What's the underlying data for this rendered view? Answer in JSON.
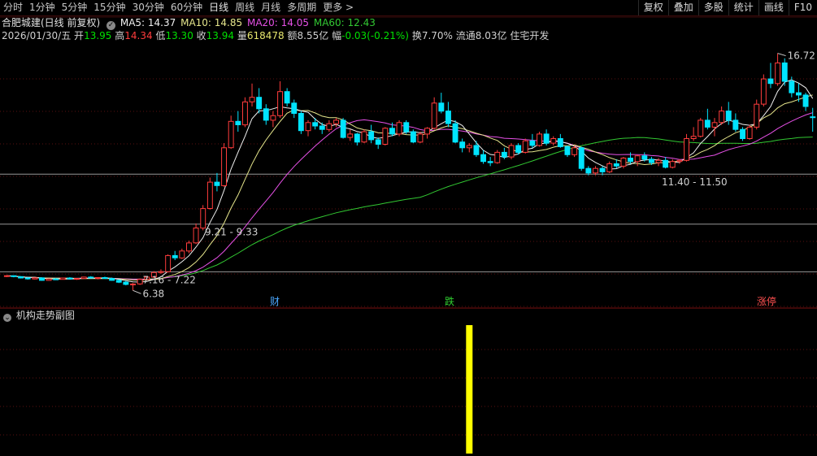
{
  "toolbar": {
    "tabs": [
      "分时",
      "1分钟",
      "5分钟",
      "15分钟",
      "30分钟",
      "60分钟",
      "日线",
      "周线",
      "月线",
      "多周期",
      "更多 >"
    ],
    "active_index": 6,
    "tools": [
      "复权",
      "叠加",
      "多股",
      "统计",
      "画线",
      "F10"
    ]
  },
  "info": {
    "stock_name": "合肥城建(日线 前复权)",
    "ma5": "MA5: 14.37",
    "ma10": "MA10: 14.85",
    "ma20": "MA20: 14.05",
    "ma60": "MA60: 12.43",
    "date": "2026/01/30/五",
    "open_label": "开",
    "open": "13.95",
    "high_label": "高",
    "high": "14.34",
    "low_label": "低",
    "low": "13.30",
    "close_label": "收",
    "close": "13.94",
    "volume_label": "量",
    "volume": "618478",
    "amount_label": "额",
    "amount": "8.55亿",
    "change_label": "幅",
    "change": "-0.03(-0.21%)",
    "turnover": "换7.70%",
    "float_cap": "流通8.03亿",
    "sector": "住宅开发"
  },
  "annotations": {
    "high_mark": "16.72",
    "low_mark": "6.38",
    "range1": "7.16 - 7.22",
    "range2": "9.21 - 9.33",
    "range3": "11.40 - 11.50",
    "marker_cai": "财",
    "marker_die": "跌",
    "marker_zhangting": "涨停"
  },
  "sub_panel": {
    "title": "机构走势副图"
  },
  "colors": {
    "up": "#ff3c3c",
    "down": "#00e4ff",
    "ma5": "#f0f0f0",
    "ma10": "#e6e68c",
    "ma20": "#e650e6",
    "ma60": "#32c832",
    "level": "#969696",
    "bar": "#ffff00"
  },
  "chart_data": {
    "type": "candlestick",
    "y_range": [
      6.0,
      17.2
    ],
    "candles": [
      [
        7.0,
        7.05,
        6.96,
        7.02
      ],
      [
        7.02,
        7.02,
        6.95,
        6.98
      ],
      [
        6.98,
        7.0,
        6.9,
        6.92
      ],
      [
        6.92,
        6.95,
        6.85,
        6.88
      ],
      [
        6.88,
        6.95,
        6.86,
        6.93
      ],
      [
        6.93,
        6.95,
        6.8,
        6.82
      ],
      [
        6.82,
        6.9,
        6.8,
        6.88
      ],
      [
        6.88,
        6.92,
        6.84,
        6.86
      ],
      [
        6.86,
        6.94,
        6.85,
        6.92
      ],
      [
        6.92,
        6.96,
        6.86,
        6.88
      ],
      [
        6.88,
        6.92,
        6.84,
        6.9
      ],
      [
        6.9,
        6.98,
        6.88,
        6.96
      ],
      [
        6.96,
        7.0,
        6.9,
        6.92
      ],
      [
        6.92,
        6.96,
        6.86,
        6.94
      ],
      [
        6.94,
        6.98,
        6.88,
        6.9
      ],
      [
        6.9,
        6.94,
        6.8,
        6.82
      ],
      [
        6.82,
        6.86,
        6.7,
        6.74
      ],
      [
        6.74,
        6.8,
        6.6,
        6.64
      ],
      [
        6.64,
        6.7,
        6.38,
        6.66
      ],
      [
        6.66,
        6.9,
        6.62,
        6.86
      ],
      [
        6.86,
        7.0,
        6.82,
        6.96
      ],
      [
        6.96,
        7.22,
        6.92,
        7.16
      ],
      [
        7.16,
        7.3,
        7.1,
        7.2
      ],
      [
        7.2,
        7.95,
        7.16,
        7.9
      ],
      [
        7.9,
        8.1,
        7.7,
        7.8
      ],
      [
        7.8,
        8.2,
        7.75,
        8.1
      ],
      [
        8.1,
        8.55,
        8.0,
        8.45
      ],
      [
        8.45,
        9.3,
        8.4,
        9.1
      ],
      [
        9.1,
        10.1,
        9.0,
        9.95
      ],
      [
        9.95,
        11.3,
        9.9,
        11.1
      ],
      [
        11.1,
        11.5,
        10.7,
        10.95
      ],
      [
        10.95,
        12.8,
        10.9,
        12.6
      ],
      [
        12.6,
        14.0,
        12.55,
        13.75
      ],
      [
        13.75,
        14.2,
        13.3,
        13.6
      ],
      [
        13.6,
        14.8,
        13.5,
        14.6
      ],
      [
        14.6,
        15.4,
        14.4,
        14.8
      ],
      [
        14.8,
        15.2,
        14.1,
        14.3
      ],
      [
        14.3,
        14.5,
        13.6,
        13.8
      ],
      [
        13.8,
        14.2,
        13.5,
        14.0
      ],
      [
        14.0,
        15.5,
        13.9,
        15.05
      ],
      [
        15.05,
        15.2,
        14.4,
        14.55
      ],
      [
        14.55,
        14.7,
        13.9,
        14.1
      ],
      [
        14.1,
        14.2,
        13.2,
        13.35
      ],
      [
        13.35,
        13.8,
        13.1,
        13.7
      ],
      [
        13.7,
        13.9,
        13.4,
        13.55
      ],
      [
        13.55,
        13.7,
        13.2,
        13.4
      ],
      [
        13.4,
        13.8,
        13.3,
        13.65
      ],
      [
        13.65,
        13.9,
        13.5,
        13.8
      ],
      [
        13.8,
        13.9,
        13.0,
        13.05
      ],
      [
        13.05,
        13.4,
        12.9,
        13.2
      ],
      [
        13.2,
        13.25,
        12.7,
        12.85
      ],
      [
        12.85,
        13.4,
        12.8,
        13.3
      ],
      [
        13.3,
        13.6,
        12.8,
        12.95
      ],
      [
        12.95,
        13.05,
        12.55,
        12.75
      ],
      [
        12.75,
        13.5,
        12.7,
        13.45
      ],
      [
        13.45,
        13.7,
        13.1,
        13.2
      ],
      [
        13.2,
        13.8,
        13.1,
        13.7
      ],
      [
        13.7,
        13.8,
        13.2,
        13.3
      ],
      [
        13.3,
        13.4,
        12.8,
        12.85
      ],
      [
        12.85,
        13.3,
        12.8,
        13.2
      ],
      [
        13.2,
        13.5,
        13.0,
        13.45
      ],
      [
        13.45,
        14.8,
        13.4,
        14.55
      ],
      [
        14.55,
        15.0,
        14.1,
        14.2
      ],
      [
        14.2,
        14.6,
        13.5,
        13.65
      ],
      [
        13.65,
        13.8,
        12.8,
        12.85
      ],
      [
        12.85,
        13.0,
        12.4,
        12.6
      ],
      [
        12.6,
        12.8,
        12.4,
        12.7
      ],
      [
        12.7,
        12.9,
        12.2,
        12.3
      ],
      [
        12.3,
        12.5,
        11.9,
        12.0
      ],
      [
        12.0,
        12.2,
        11.8,
        11.95
      ],
      [
        11.95,
        12.5,
        11.9,
        12.4
      ],
      [
        12.4,
        12.6,
        12.1,
        12.2
      ],
      [
        12.2,
        12.8,
        12.1,
        12.7
      ],
      [
        12.7,
        12.8,
        12.3,
        12.4
      ],
      [
        12.4,
        13.0,
        12.35,
        12.9
      ],
      [
        12.9,
        13.2,
        12.6,
        12.7
      ],
      [
        12.7,
        13.3,
        12.65,
        13.2
      ],
      [
        13.2,
        13.4,
        12.7,
        12.8
      ],
      [
        12.8,
        13.1,
        12.7,
        13.0
      ],
      [
        13.0,
        13.2,
        12.6,
        12.65
      ],
      [
        12.65,
        12.7,
        12.2,
        12.3
      ],
      [
        12.3,
        12.7,
        12.2,
        12.6
      ],
      [
        12.6,
        12.65,
        11.6,
        11.7
      ],
      [
        11.7,
        11.8,
        11.4,
        11.5
      ],
      [
        11.5,
        11.8,
        11.4,
        11.7
      ],
      [
        11.7,
        11.8,
        11.4,
        11.55
      ],
      [
        11.55,
        12.0,
        11.5,
        11.9
      ],
      [
        11.9,
        12.1,
        11.7,
        11.8
      ],
      [
        11.8,
        12.2,
        11.7,
        12.15
      ],
      [
        12.15,
        12.4,
        11.9,
        12.0
      ],
      [
        12.0,
        12.3,
        11.8,
        12.25
      ],
      [
        12.25,
        12.4,
        12.0,
        12.1
      ],
      [
        12.1,
        12.2,
        11.85,
        11.95
      ],
      [
        11.95,
        12.15,
        11.8,
        12.05
      ],
      [
        12.05,
        12.2,
        11.7,
        11.75
      ],
      [
        11.75,
        12.1,
        11.7,
        12.0
      ],
      [
        12.0,
        12.1,
        11.9,
        12.05
      ],
      [
        12.05,
        13.2,
        12.0,
        13.0
      ],
      [
        13.0,
        13.5,
        12.9,
        13.1
      ],
      [
        13.1,
        13.9,
        13.05,
        13.8
      ],
      [
        13.8,
        14.3,
        13.4,
        13.5
      ],
      [
        13.5,
        13.9,
        13.1,
        13.7
      ],
      [
        13.7,
        14.4,
        13.6,
        14.2
      ],
      [
        14.2,
        14.6,
        13.6,
        13.8
      ],
      [
        13.8,
        14.1,
        13.3,
        13.4
      ],
      [
        13.4,
        13.5,
        12.9,
        13.0
      ],
      [
        13.0,
        13.6,
        12.95,
        13.5
      ],
      [
        13.5,
        14.7,
        13.4,
        14.5
      ],
      [
        14.5,
        15.8,
        14.4,
        15.6
      ],
      [
        15.6,
        16.3,
        15.2,
        15.4
      ],
      [
        15.4,
        16.72,
        15.3,
        16.3
      ],
      [
        16.3,
        16.5,
        15.3,
        15.5
      ],
      [
        15.5,
        15.7,
        14.8,
        15.0
      ],
      [
        15.0,
        15.4,
        14.6,
        14.9
      ],
      [
        14.9,
        15.0,
        14.2,
        14.4
      ],
      [
        13.95,
        14.34,
        13.3,
        13.94
      ]
    ],
    "price_levels": [
      7.19,
      9.27,
      11.45
    ],
    "sub_panel_bar": {
      "index": 66,
      "value": 1
    }
  }
}
